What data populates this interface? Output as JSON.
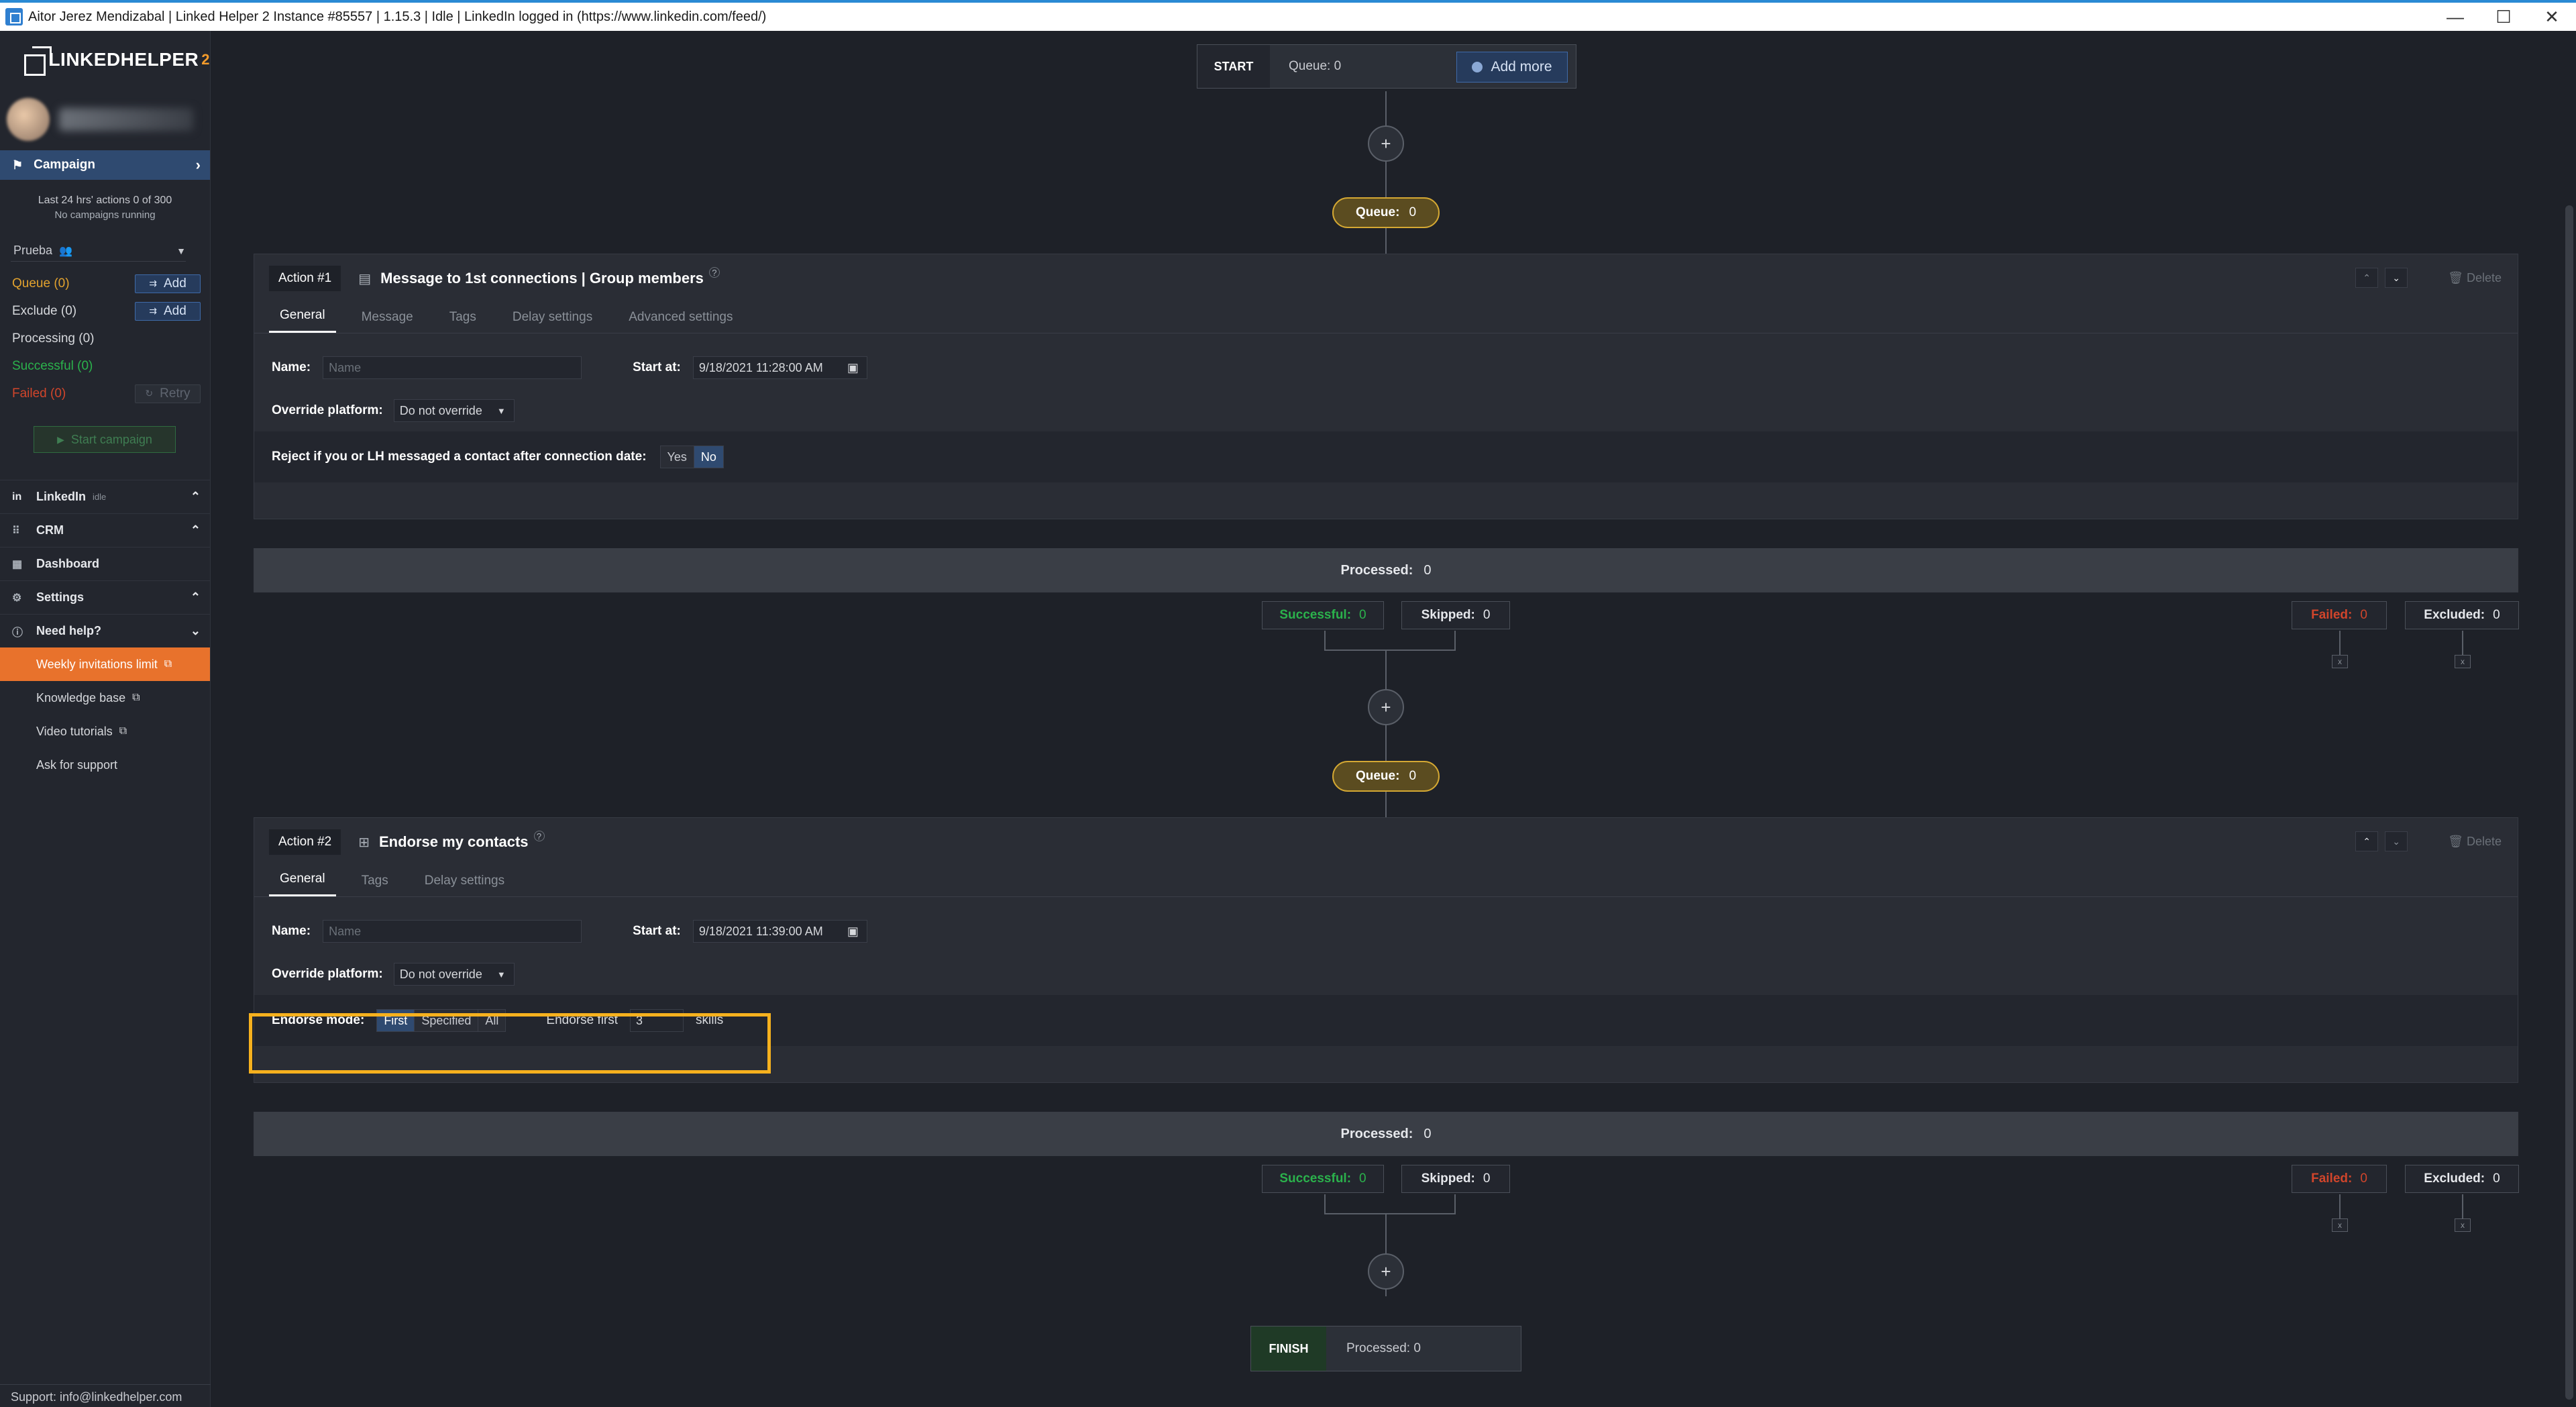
{
  "window": {
    "title": "Aitor Jerez Mendizabal | Linked Helper 2 Instance #85557 | 1.15.3 | Idle | LinkedIn logged in (https://www.linkedin.com/feed/)",
    "minimize": "—",
    "maximize": "☐",
    "close": "✕"
  },
  "sidebar": {
    "logo_text": "LINKEDHELPER",
    "logo_sup": "2",
    "campaign_label": "Campaign",
    "actions_info": "Last 24 hrs' actions 0 of 300",
    "actions_sub": "No campaigns running",
    "campaign_name": "Prueba",
    "stats": {
      "queue": "Queue (0)",
      "exclude": "Exclude (0)",
      "processing": "Processing (0)",
      "successful": "Successful (0)",
      "failed": "Failed (0)",
      "add": "Add",
      "retry": "Retry"
    },
    "start_campaign": "Start campaign",
    "sections": {
      "linkedin": "LinkedIn",
      "linkedin_status": "idle",
      "crm": "CRM",
      "dashboard": "Dashboard",
      "settings": "Settings",
      "need_help": "Need help?"
    },
    "help_items": [
      "Weekly invitations limit",
      "Knowledge base",
      "Video tutorials",
      "Ask for support"
    ],
    "support": "Support: info@linkedhelper.com"
  },
  "flow": {
    "start_label": "START",
    "start_queue": "Queue: 0",
    "add_more": "Add more",
    "queue_label": "Queue:",
    "queue_value": "0",
    "finish_label": "FINISH",
    "finish_processed": "Processed: 0"
  },
  "action1": {
    "tag": "Action #1",
    "title": "Message to 1st connections | Group members",
    "delete": "Delete",
    "tabs": [
      "General",
      "Message",
      "Tags",
      "Delay settings",
      "Advanced settings"
    ],
    "name_label": "Name:",
    "name_placeholder": "Name",
    "start_at_label": "Start at:",
    "start_at_value": "9/18/2021 11:28:00 AM",
    "override_label": "Override platform:",
    "override_value": "Do not override",
    "reject_label": "Reject if you or LH messaged a contact after connection date:",
    "yes": "Yes",
    "no": "No",
    "processed_label": "Processed:",
    "processed_value": "0",
    "successful_label": "Successful:",
    "successful_value": "0",
    "skipped_label": "Skipped:",
    "skipped_value": "0",
    "failed_label": "Failed:",
    "failed_value": "0",
    "excluded_label": "Excluded:",
    "excluded_value": "0"
  },
  "action2": {
    "tag": "Action #2",
    "title": "Endorse my contacts",
    "delete": "Delete",
    "tabs": [
      "General",
      "Tags",
      "Delay settings"
    ],
    "name_label": "Name:",
    "name_placeholder": "Name",
    "start_at_label": "Start at:",
    "start_at_value": "9/18/2021 11:39:00 AM",
    "override_label": "Override platform:",
    "override_value": "Do not override",
    "endorse_mode_label": "Endorse mode:",
    "mode_first": "First",
    "mode_specified": "Specified",
    "mode_all": "All",
    "endorse_first_label": "Endorse first",
    "endorse_first_value": "3",
    "skills_label": "skills",
    "processed_label": "Processed:",
    "processed_value": "0",
    "successful_label": "Successful:",
    "successful_value": "0",
    "skipped_label": "Skipped:",
    "skipped_value": "0",
    "failed_label": "Failed:",
    "failed_value": "0",
    "excluded_label": "Excluded:",
    "excluded_value": "0"
  },
  "colors": {
    "accent": "#2f4a70",
    "queue": "#e2a22e",
    "success": "#2bb24c",
    "failed": "#d1452b",
    "highlight": "#f6b11e",
    "orange_item": "#e8722c"
  }
}
